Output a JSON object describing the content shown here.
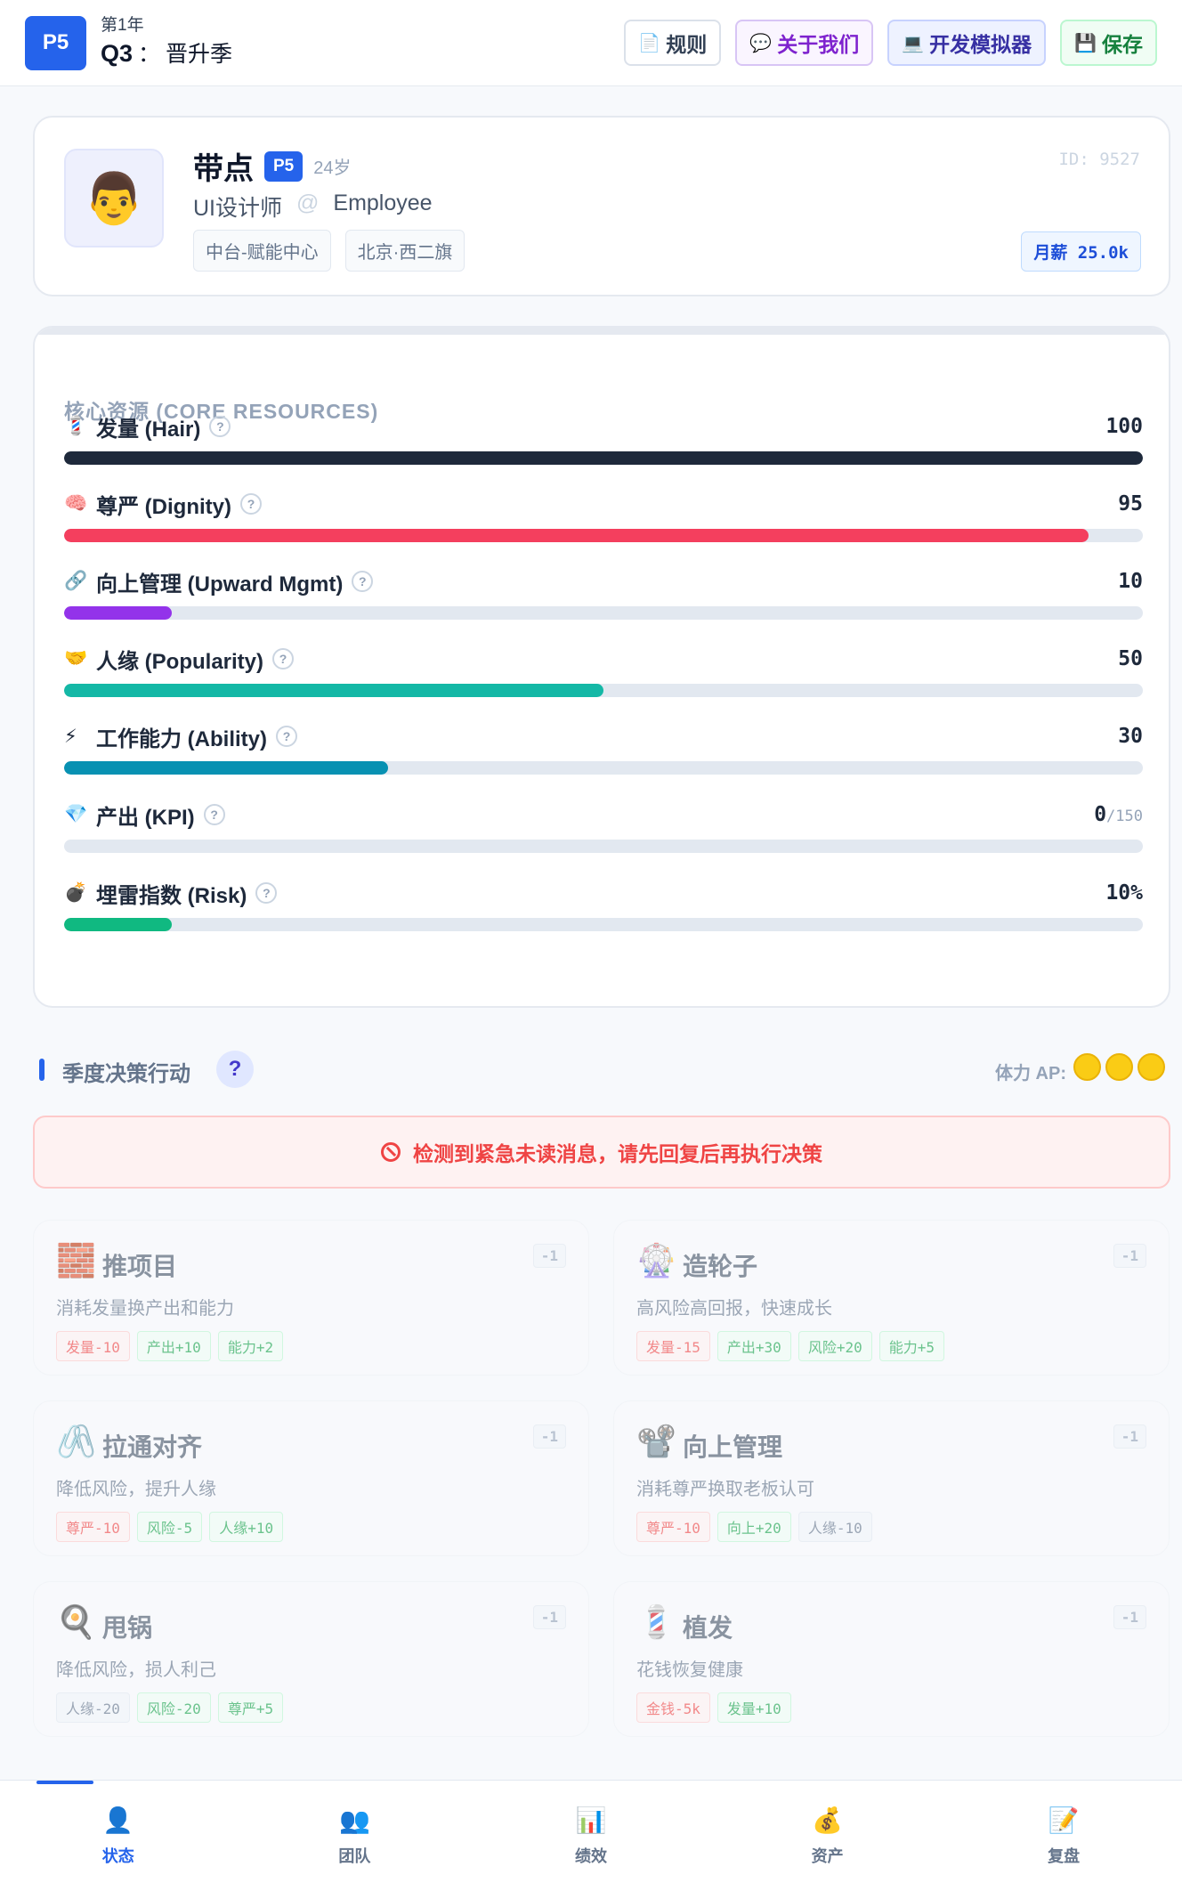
{
  "header": {
    "level_badge": "P5",
    "year": "第1年",
    "quarter": "Q3",
    "quarter_sep": "：",
    "season": "晋升季",
    "buttons": {
      "rules": {
        "icon": "📄",
        "label": "规则"
      },
      "about": {
        "icon": "💬",
        "label": "关于我们"
      },
      "dev": {
        "icon": "💻",
        "label": "开发模拟器"
      },
      "save": {
        "icon": "💾",
        "label": "保存"
      }
    }
  },
  "profile": {
    "avatar": "👨",
    "name": "带点",
    "level": "P5",
    "age": "24岁",
    "id": "ID: 9527",
    "role": "UI设计师",
    "at": "@",
    "employee_type": "Employee",
    "tags": [
      "中台-赋能中心",
      "北京·西二旗"
    ],
    "salary": "月薪 25.0k"
  },
  "resources": {
    "title": "核心资源 (CORE RESOURCES)",
    "items": [
      {
        "emoji": "💈",
        "label": "发量 (Hair)",
        "value": "100",
        "max": "",
        "fill": 100,
        "color": "#1e293b"
      },
      {
        "emoji": "🧠",
        "label": "尊严 (Dignity)",
        "value": "95",
        "max": "",
        "fill": 95,
        "color": "#f43f5e"
      },
      {
        "emoji": "🔗",
        "label": "向上管理 (Upward Mgmt)",
        "value": "10",
        "max": "",
        "fill": 10,
        "color": "#9333ea"
      },
      {
        "emoji": "🤝",
        "label": "人缘 (Popularity)",
        "value": "50",
        "max": "",
        "fill": 50,
        "color": "#14b8a6"
      },
      {
        "emoji": "⚡",
        "label": "工作能力 (Ability)",
        "value": "30",
        "max": "",
        "fill": 30,
        "color": "#0891b2"
      },
      {
        "emoji": "💎",
        "label": "产出 (KPI)",
        "value": "0",
        "max": "/150",
        "fill": 0,
        "color": "#3b82f6"
      },
      {
        "emoji": "💣",
        "label": "埋雷指数 (Risk)",
        "value": "10%",
        "max": "",
        "fill": 10,
        "color": "#10b981"
      }
    ]
  },
  "decisions": {
    "title": "季度决策行动",
    "help": "?",
    "ap_label": "体力 AP:",
    "ap_count": 3,
    "alert": "检测到紧急未读消息，请先回复后再执行决策",
    "actions": [
      {
        "icon": "🧱",
        "title": "推项目",
        "cost": "-1",
        "desc": "消耗发量换产出和能力",
        "effects": [
          {
            "t": "发量-10",
            "k": "neg"
          },
          {
            "t": "产出+10",
            "k": "pos"
          },
          {
            "t": "能力+2",
            "k": "pos"
          }
        ]
      },
      {
        "icon": "🎡",
        "title": "造轮子",
        "cost": "-1",
        "desc": "高风险高回报，快速成长",
        "effects": [
          {
            "t": "发量-15",
            "k": "neg"
          },
          {
            "t": "产出+30",
            "k": "pos"
          },
          {
            "t": "风险+20",
            "k": "pos"
          },
          {
            "t": "能力+5",
            "k": "pos"
          }
        ]
      },
      {
        "icon": "🖇️",
        "title": "拉通对齐",
        "cost": "-1",
        "desc": "降低风险，提升人缘",
        "effects": [
          {
            "t": "尊严-10",
            "k": "neg"
          },
          {
            "t": "风险-5",
            "k": "pos"
          },
          {
            "t": "人缘+10",
            "k": "pos"
          }
        ]
      },
      {
        "icon": "📽️",
        "title": "向上管理",
        "cost": "-1",
        "desc": "消耗尊严换取老板认可",
        "effects": [
          {
            "t": "尊严-10",
            "k": "neg"
          },
          {
            "t": "向上+20",
            "k": "pos"
          },
          {
            "t": "人缘-10",
            "k": "neu"
          }
        ]
      },
      {
        "icon": "🍳",
        "title": "甩锅",
        "cost": "-1",
        "desc": "降低风险，损人利己",
        "effects": [
          {
            "t": "人缘-20",
            "k": "neu"
          },
          {
            "t": "风险-20",
            "k": "pos"
          },
          {
            "t": "尊严+5",
            "k": "pos"
          }
        ]
      },
      {
        "icon": "💈",
        "title": "植发",
        "cost": "-1",
        "desc": "花钱恢复健康",
        "effects": [
          {
            "t": "金钱-5k",
            "k": "neg"
          },
          {
            "t": "发量+10",
            "k": "pos"
          }
        ]
      }
    ]
  },
  "nav": [
    {
      "icon": "👤",
      "label": "状态",
      "active": true
    },
    {
      "icon": "👥",
      "label": "团队",
      "active": false
    },
    {
      "icon": "📊",
      "label": "绩效",
      "active": false
    },
    {
      "icon": "💰",
      "label": "资产",
      "active": false
    },
    {
      "icon": "📝",
      "label": "复盘",
      "active": false
    }
  ]
}
